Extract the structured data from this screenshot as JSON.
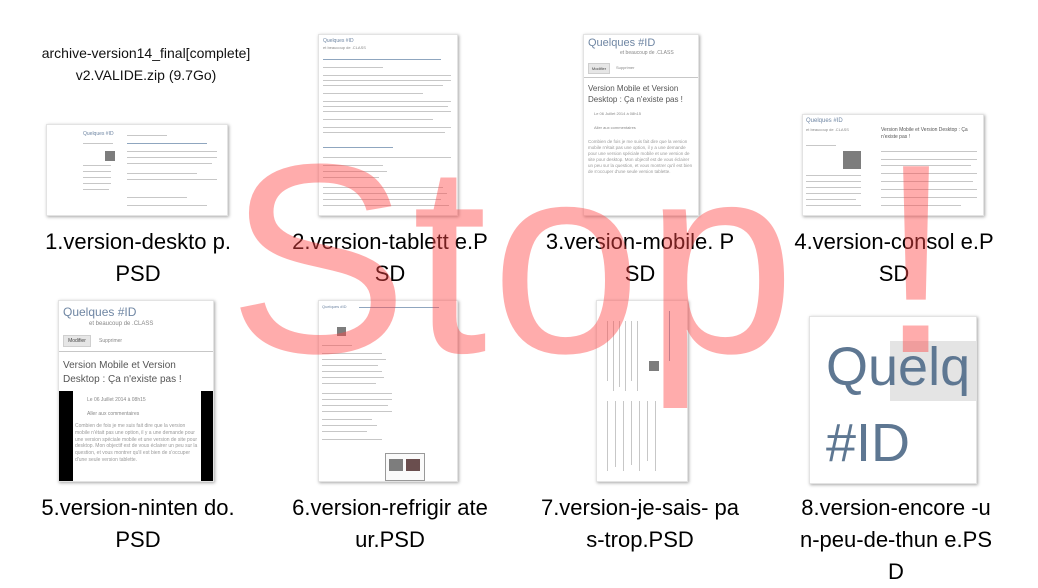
{
  "archive": {
    "line1": "archive-version14_final[complete]",
    "line2": "v2.VALIDE.zip (9.7Go)"
  },
  "files": [
    {
      "name": "1.version-deskto p.PSD"
    },
    {
      "name": "2.version-tablett e.PSD"
    },
    {
      "name": "3.version-mobile. PSD"
    },
    {
      "name": "4.version-consol e.PSD"
    },
    {
      "name": "5.version-ninten do.PSD"
    },
    {
      "name": "6.version-refrigir ateur.PSD"
    },
    {
      "name": "7.version-je-sais- pas-trop.PSD"
    },
    {
      "name": "8.version-encore -un-peu-de-thun e.PSD"
    }
  ],
  "thumbs": {
    "blog_title": "Quelques #ID",
    "blog_subtitle": "et beaucoup de .CLASS",
    "btn_modify": "Modifier",
    "btn_delete": "Supprimer",
    "post_title": "Version Mobile et Version Desktop : Ça n'existe pas !",
    "post_date": "Le 06 Juillet 2014 à 08h15",
    "post_comments": "Aller aux commentaires",
    "post_excerpt": "Combien de fois je me suis fait dire que la version mobile n'était pas une option, il y a une demande pour une version spéciale mobile et une version de site pour desktop. Mon objectif est de vous éclairer un peu sur la question, et vous montrer qu'il est bien de s'occuper d'une seule version tablette.",
    "big_title": "Quelq",
    "big_title2": "#ID"
  },
  "overlay": {
    "stop_text": "Stop !"
  },
  "colors": {
    "stop": "#ff4646",
    "thumb_title": "#6f86a3"
  }
}
